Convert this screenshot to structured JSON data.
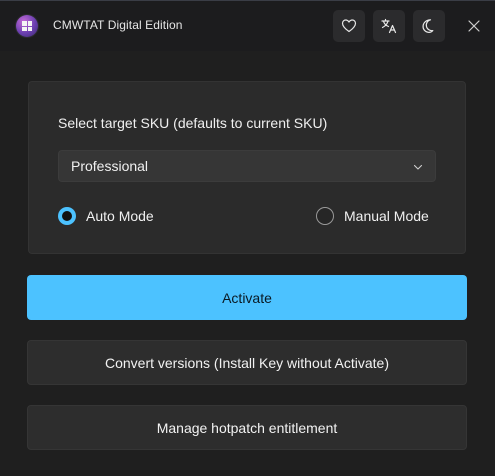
{
  "window": {
    "title": "CMWTAT Digital Edition"
  },
  "titlebar": {
    "app_icon": "windows-logo-icon",
    "buttons": [
      {
        "name": "favorite",
        "icon": "heart-icon"
      },
      {
        "name": "language",
        "icon": "translate-icon"
      },
      {
        "name": "theme",
        "icon": "moon-icon"
      }
    ],
    "close_icon": "close-icon"
  },
  "sku": {
    "label": "Select target SKU (defaults to current SKU)",
    "selected": "Professional"
  },
  "mode": {
    "auto_label": "Auto Mode",
    "manual_label": "Manual Mode",
    "selected": "auto"
  },
  "actions": {
    "activate": "Activate",
    "convert": "Convert versions (Install Key without Activate)",
    "hotpatch": "Manage hotpatch entitlement"
  },
  "colors": {
    "accent": "#4cc2ff",
    "background": "#1f1f1f",
    "card": "#2b2b2b"
  }
}
